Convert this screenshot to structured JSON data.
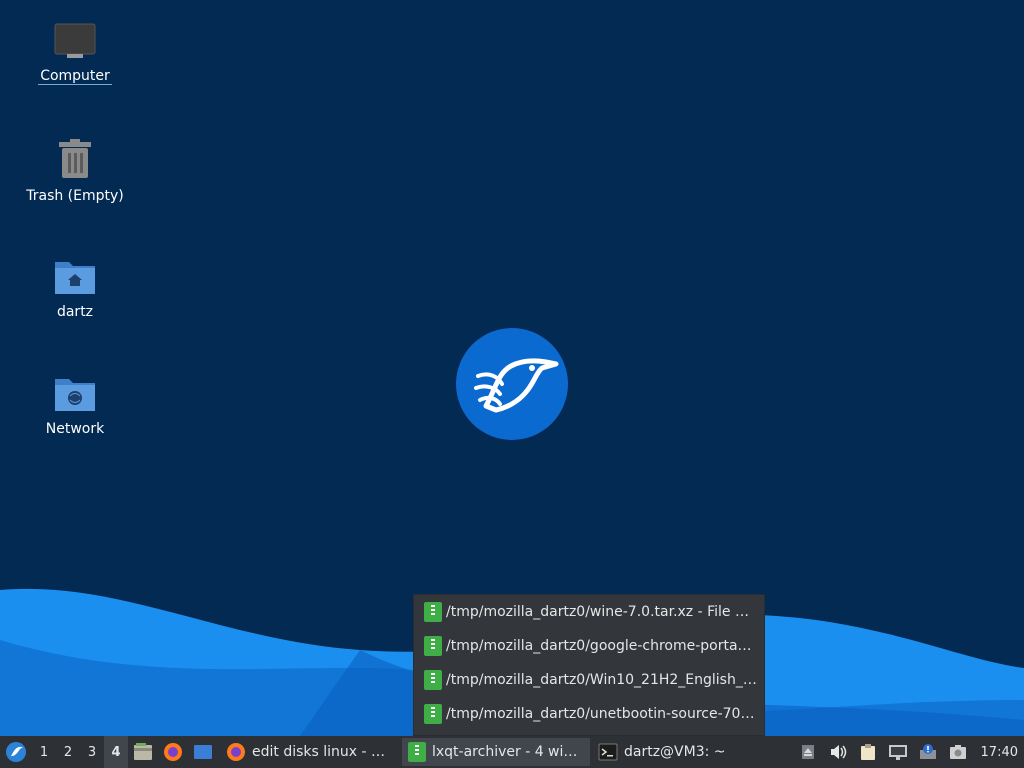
{
  "desktop": {
    "icons": [
      {
        "label": "Computer",
        "icon": "computer-icon"
      },
      {
        "label": "Trash (Empty)",
        "icon": "trash-icon"
      },
      {
        "label": "dartz",
        "icon": "home-folder-icon"
      },
      {
        "label": "Network",
        "icon": "network-folder-icon"
      }
    ],
    "colors": {
      "background": "#022a52",
      "wave_light": "#1a8ff0",
      "wave_dark": "#0f6fd0"
    }
  },
  "popup": {
    "items": [
      "/tmp/mozilla_dartz0/wine-7.0.tar.xz - File A…",
      "/tmp/mozilla_dartz0/google-chrome-porta…",
      "/tmp/mozilla_dartz0/Win10_21H2_English_…",
      "/tmp/mozilla_dartz0/unetbootin-source-70…"
    ]
  },
  "taskbar": {
    "desktops": [
      "1",
      "2",
      "3",
      "4"
    ],
    "active_desktop": "4",
    "quicklaunch": [
      "file-manager-icon",
      "firefox-icon",
      "desktop-show-icon"
    ],
    "tasks": [
      {
        "label": "edit disks linux - Goo…",
        "icon": "firefox-icon"
      },
      {
        "label": "lxqt-archiver - 4 wind…",
        "icon": "archive-icon",
        "active": true
      },
      {
        "label": "dartz@VM3: ~",
        "icon": "terminal-icon"
      }
    ],
    "tray": [
      "eject-icon",
      "volume-icon",
      "clipboard-icon",
      "network-wired-icon",
      "update-notifier-icon",
      "screenshot-icon"
    ],
    "clock": "17:40"
  }
}
